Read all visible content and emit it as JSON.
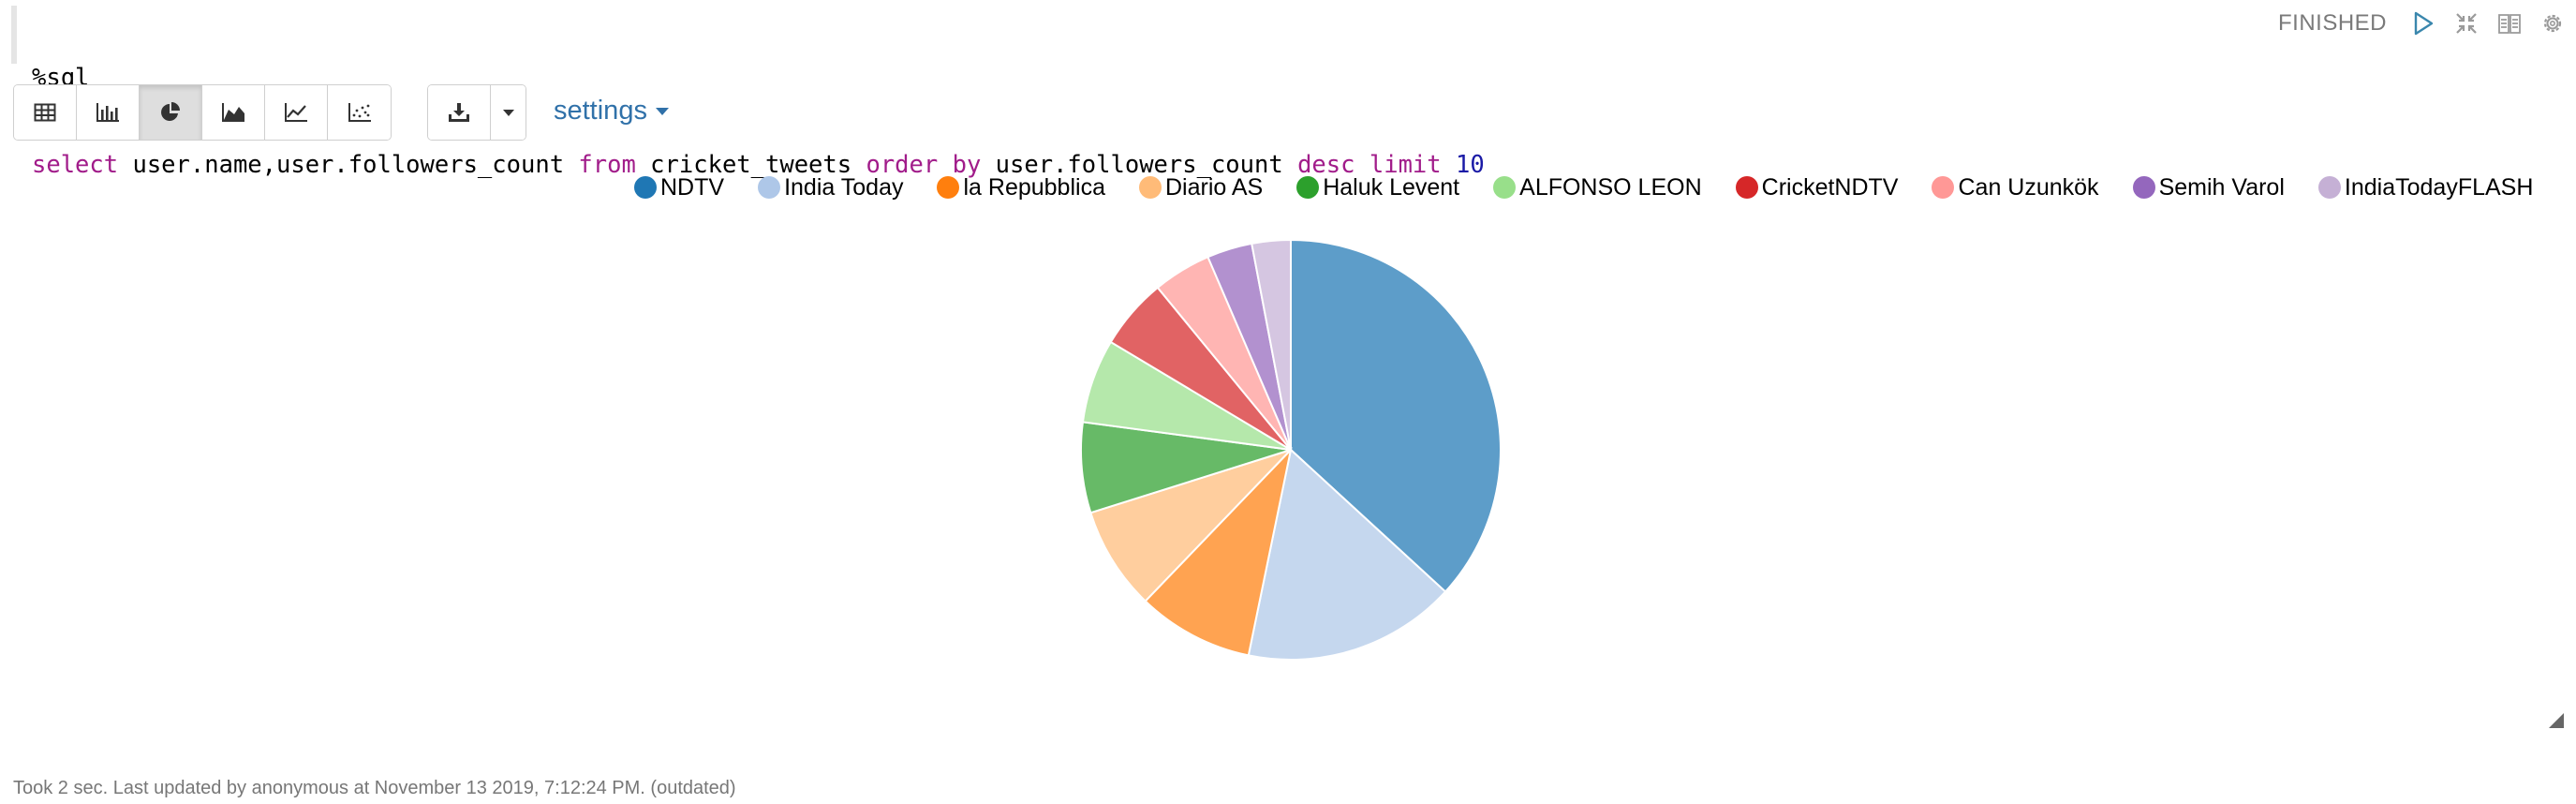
{
  "editor": {
    "line1": "%sql",
    "line2": [
      {
        "text": "select",
        "kw": true
      },
      {
        "text": " user.name,user.followers_count ",
        "kw": false
      },
      {
        "text": "from",
        "kw": true
      },
      {
        "text": " cricket_tweets ",
        "kw": false
      },
      {
        "text": "order",
        "kw": true
      },
      {
        "text": " ",
        "kw": false
      },
      {
        "text": "by",
        "kw": true
      },
      {
        "text": " user.followers_count ",
        "kw": false
      },
      {
        "text": "desc",
        "kw": true
      },
      {
        "text": " ",
        "kw": false
      },
      {
        "text": "limit",
        "kw": true
      },
      {
        "text": " ",
        "kw": false
      },
      {
        "text": "10",
        "num": true
      }
    ]
  },
  "status": {
    "text": "FINISHED",
    "icons": [
      "run-icon",
      "collapse-icon",
      "book-icon",
      "gear-icon"
    ],
    "accent": "#3a87ad"
  },
  "toolbar": {
    "viz_icons": [
      "table-icon",
      "bar-chart-icon",
      "pie-chart-icon",
      "area-chart-icon",
      "line-chart-icon",
      "scatter-chart-icon"
    ],
    "active_index": 2,
    "download_icon": "download-icon",
    "settings_label": "settings"
  },
  "chart_data": {
    "type": "pie",
    "categories": [
      "NDTV",
      "India Today",
      "la Repubblica",
      "Diario AS",
      "Haluk Levent",
      "ALFONSO LEON",
      "CricketNDTV",
      "Can Uzunkök",
      "Semih Varol",
      "IndiaTodayFLASH"
    ],
    "values": [
      37.0,
      16.5,
      9.0,
      8.0,
      7.0,
      6.5,
      5.5,
      4.5,
      3.5,
      3.0
    ],
    "colors": [
      "#1f77b4",
      "#aec7e8",
      "#ff7f0e",
      "#ffbb78",
      "#2ca02c",
      "#98df8a",
      "#d62728",
      "#ff9896",
      "#9467bd",
      "#c5b0d5"
    ],
    "legend": "top"
  },
  "footer": {
    "text": "Took 2 sec. Last updated by anonymous at November 13 2019, 7:12:24 PM. (outdated)"
  }
}
